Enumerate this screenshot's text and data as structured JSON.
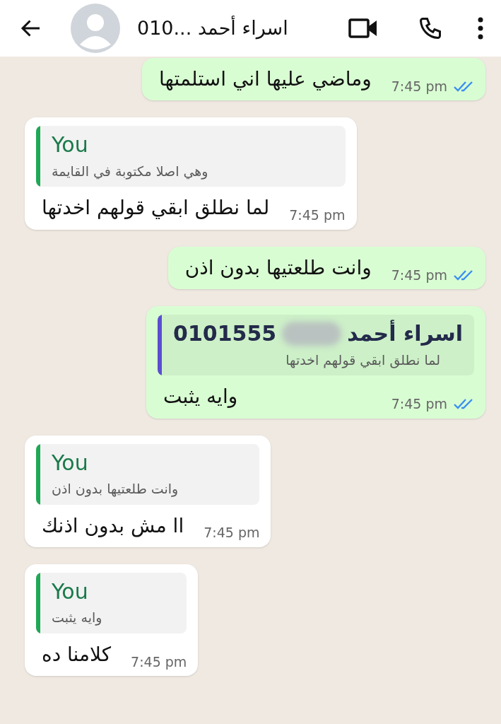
{
  "header": {
    "title": "010... اسراء أحمد"
  },
  "messages": [
    {
      "kind": "outgoing",
      "text": "وماضي عليها اني استلمتها",
      "time": "7:45 pm",
      "read": true
    },
    {
      "kind": "incoming",
      "quote": {
        "author": "You",
        "text": "وهي اصلا مكتوبة في القايمة",
        "color": "#1fa855"
      },
      "text": "لما نطلق ابقي قولهم اخدتها",
      "time": "7:45 pm"
    },
    {
      "kind": "outgoing",
      "text": "وانت طلعتيها بدون اذن",
      "time": "7:45 pm",
      "read": true
    },
    {
      "kind": "outgoing",
      "quote": {
        "author": "اسراء أحمد",
        "number": "0101555",
        "redacted": true,
        "text": "لما نطلق ابقي قولهم اخدتها",
        "color": "#5b4fd1"
      },
      "text": "وايه يثبت",
      "time": "7:45 pm",
      "read": true
    },
    {
      "kind": "incoming",
      "quote": {
        "author": "You",
        "text": "وانت طلعتيها بدون اذن",
        "color": "#1fa855"
      },
      "text": "اا مش بدون اذنك",
      "time": "7:45 pm"
    },
    {
      "kind": "incoming",
      "quote": {
        "author": "You",
        "text": "وايه يثبت",
        "color": "#1fa855"
      },
      "text": "كلامنا ده",
      "time": "7:45 pm"
    }
  ]
}
